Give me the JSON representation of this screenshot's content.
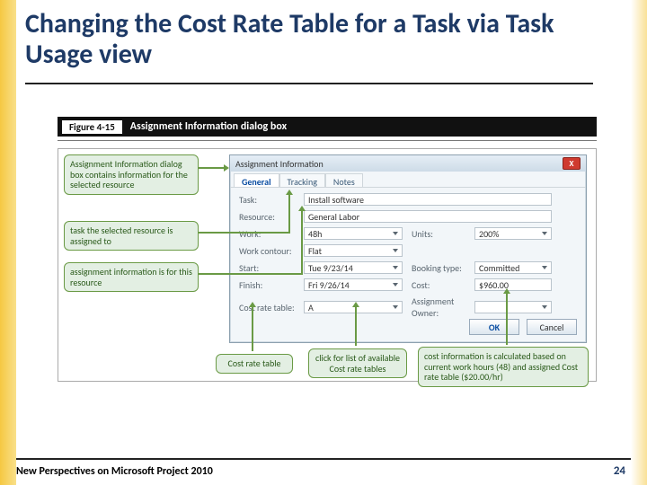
{
  "title": "Changing the Cost Rate Table for a Task via Task Usage view",
  "figure": {
    "badge": "Figure 4-15",
    "title": "Assignment Information dialog box"
  },
  "dialog": {
    "title": "Assignment Information",
    "close": "X",
    "tabs": {
      "general": "General",
      "tracking": "Tracking",
      "notes": "Notes"
    },
    "fields": {
      "task_lbl": "Task:",
      "task_val": "Install software",
      "resource_lbl": "Resource:",
      "resource_val": "General Labor",
      "work_lbl": "Work:",
      "work_val": "48h",
      "units_lbl": "Units:",
      "units_val": "200%",
      "contour_lbl": "Work contour:",
      "contour_val": "Flat",
      "start_lbl": "Start:",
      "start_val": "Tue 9/23/14",
      "booking_lbl": "Booking type:",
      "booking_val": "Committed",
      "finish_lbl": "Finish:",
      "finish_val": "Fri 9/26/14",
      "cost_lbl": "Cost:",
      "cost_val": "$960.00",
      "crt_lbl": "Cost rate table:",
      "crt_val": "A",
      "owner_lbl": "Assignment Owner:",
      "owner_val": ""
    },
    "buttons": {
      "ok": "OK",
      "cancel": "Cancel"
    }
  },
  "callouts": {
    "c1": "Assignment Information dialog box contains information for the selected resource",
    "c2": "task the selected resource is assigned to",
    "c3": "assignment information is for this resource",
    "c4": "Cost rate table",
    "c5": "click for list of available Cost rate tables",
    "c6": "cost information is calculated based on current work hours (48) and assigned Cost rate table ($20.00/hr)"
  },
  "footer": {
    "left": "New Perspectives on Microsoft Project 2010",
    "page": "24"
  }
}
